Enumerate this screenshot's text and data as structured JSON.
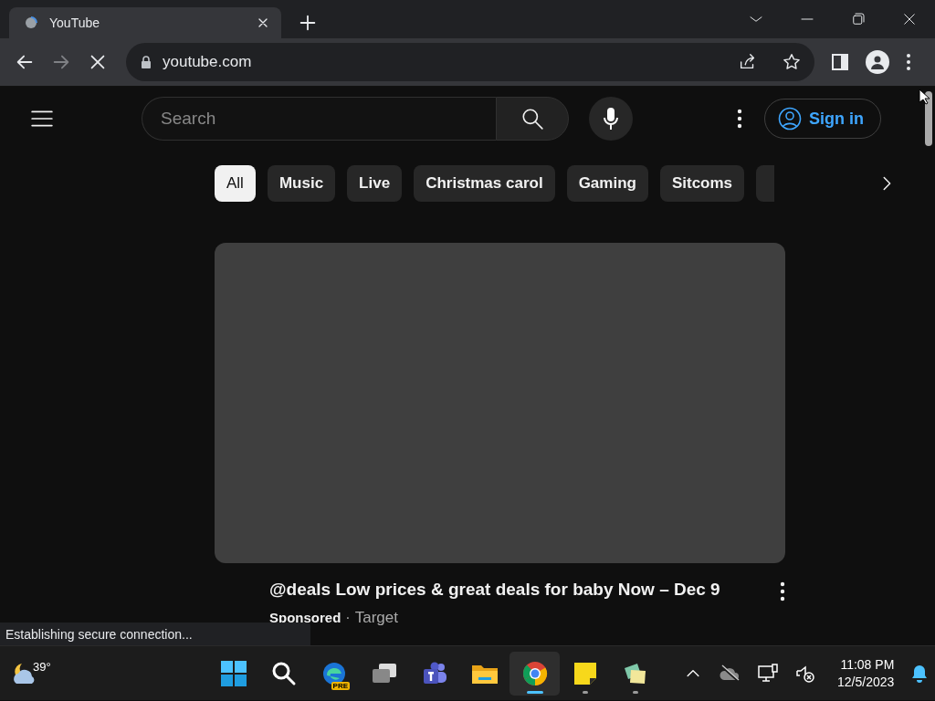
{
  "browser": {
    "tabs": [
      {
        "title": "YouTube",
        "selected": true
      }
    ],
    "address": "youtube.com",
    "loading": true,
    "status_text": "Establishing secure connection..."
  },
  "page": {
    "search": {
      "placeholder": "Search"
    },
    "sign_in": "Sign in",
    "chips": [
      {
        "label": "All",
        "selected": true
      },
      {
        "label": "Music",
        "selected": false
      },
      {
        "label": "Live",
        "selected": false
      },
      {
        "label": "Christmas carol",
        "selected": false
      },
      {
        "label": "Gaming",
        "selected": false
      },
      {
        "label": "Sitcoms",
        "selected": false
      }
    ],
    "video": {
      "title": "@deals Low prices & great deals for baby Now – Dec 9",
      "sponsored": "Sponsored",
      "separator": "·",
      "channel": "Target"
    }
  },
  "taskbar": {
    "weather": "39°",
    "apps": [
      {
        "kind": "start",
        "selected": false,
        "running": false
      },
      {
        "kind": "search",
        "selected": false,
        "running": false
      },
      {
        "kind": "edge",
        "badge": "PRE",
        "selected": false,
        "running": false
      },
      {
        "kind": "taskview",
        "selected": false,
        "running": false
      },
      {
        "kind": "teams",
        "selected": false,
        "running": false
      },
      {
        "kind": "explorer",
        "selected": false,
        "running": false
      },
      {
        "kind": "chrome",
        "selected": true,
        "running": true
      },
      {
        "kind": "sticky",
        "selected": false,
        "running": true
      },
      {
        "kind": "notes",
        "selected": false,
        "running": true
      }
    ],
    "time": "11:08 PM",
    "date": "12/5/2023"
  }
}
